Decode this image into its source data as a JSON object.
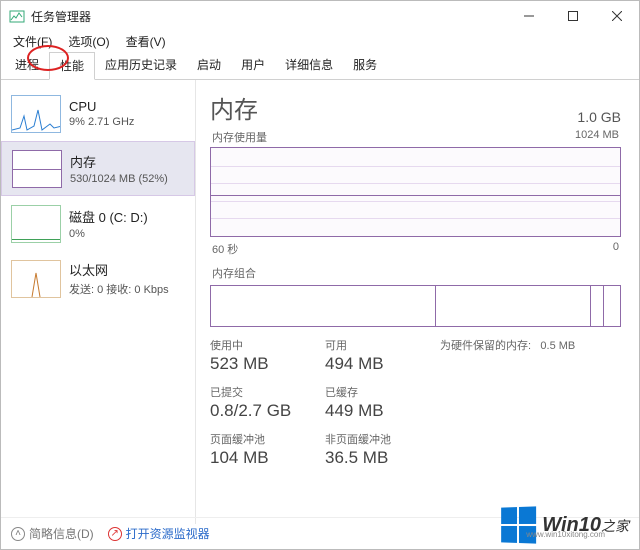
{
  "window": {
    "title": "任务管理器"
  },
  "menu": {
    "file": "文件(F)",
    "options": "选项(O)",
    "view": "查看(V)"
  },
  "tabs": [
    {
      "label": "进程"
    },
    {
      "label": "性能"
    },
    {
      "label": "应用历史记录"
    },
    {
      "label": "启动"
    },
    {
      "label": "用户"
    },
    {
      "label": "详细信息"
    },
    {
      "label": "服务"
    }
  ],
  "sidebar": {
    "cpu": {
      "name": "CPU",
      "sub": "9% 2.71 GHz",
      "color": "#2a7ed2"
    },
    "mem": {
      "name": "内存",
      "sub": "530/1024 MB (52%)",
      "color": "#8f6aa8"
    },
    "disk": {
      "name": "磁盘 0 (C: D:)",
      "sub": "0%",
      "color": "#3fa158"
    },
    "net": {
      "name": "以太网",
      "sub": "发送: 0 接收: 0 Kbps",
      "color": "#c67a2f"
    }
  },
  "main": {
    "heading": "内存",
    "capacity": "1.0 GB",
    "graph": {
      "label": "内存使用量",
      "max": "1024 MB",
      "xleft": "60 秒",
      "xright": "0"
    },
    "composition_label": "内存组合",
    "stats": {
      "in_use": {
        "label": "使用中",
        "value": "523 MB"
      },
      "available": {
        "label": "可用",
        "value": "494 MB"
      },
      "reserved": {
        "label": "为硬件保留的内存:",
        "value": "0.5 MB"
      },
      "committed": {
        "label": "已提交",
        "value": "0.8/2.7 GB"
      },
      "cached": {
        "label": "已缓存",
        "value": "449 MB"
      },
      "paged": {
        "label": "页面缓冲池",
        "value": "104 MB"
      },
      "nonpaged": {
        "label": "非页面缓冲池",
        "value": "36.5 MB"
      }
    }
  },
  "footer": {
    "fewer": "简略信息(D)",
    "resmon": "打开资源监视器"
  },
  "watermark": {
    "brand": "Win10",
    "suffix": "之家",
    "url": "www.win10xitong.com"
  }
}
